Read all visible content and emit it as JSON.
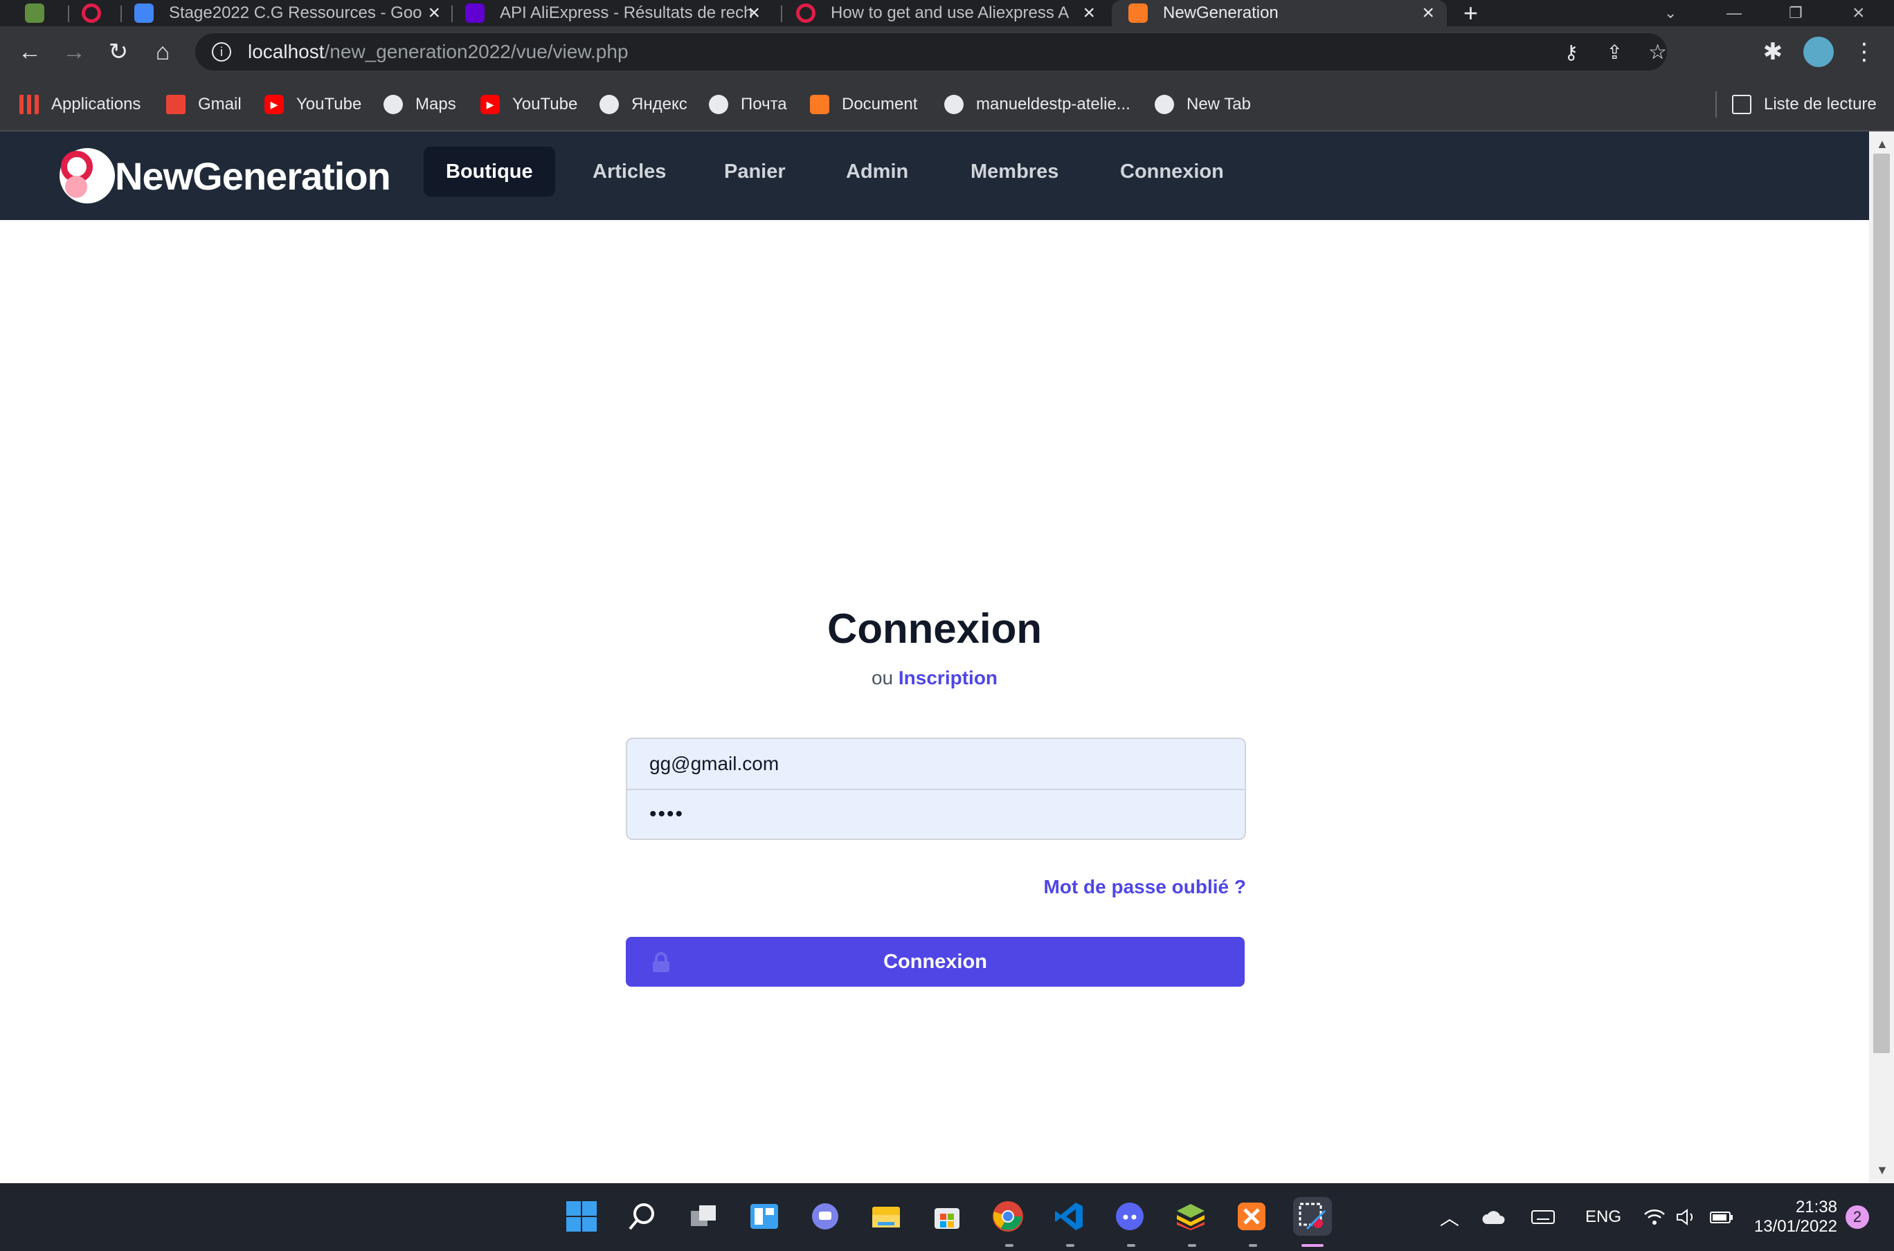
{
  "browser": {
    "tabs": [
      {
        "title": "",
        "favicon": "shopify-icon",
        "color": "#5e8e3e"
      },
      {
        "title": "",
        "favicon": "sync-icon",
        "color": "#e11d48"
      },
      {
        "title": "Stage2022 C.G Ressources - Goo",
        "favicon": "google-docs-icon",
        "color": "#4285f4"
      },
      {
        "title": "API AliExpress - Résultats de rech",
        "favicon": "yahoo-icon",
        "color": "#6001d2"
      },
      {
        "title": "How to get and use Aliexpress A",
        "favicon": "sync-icon",
        "color": "#e11d48"
      },
      {
        "title": "NewGeneration",
        "favicon": "xampp-icon",
        "color": "#fb7a24",
        "active": true
      }
    ],
    "new_tab_label": "+",
    "url_host": "localhost",
    "url_path": "/new_generation2022/vue/view.php",
    "bookmarks": [
      {
        "label": "Applications",
        "icon": "apps-grid-icon"
      },
      {
        "label": "Gmail",
        "icon": "gmail-icon"
      },
      {
        "label": "YouTube",
        "icon": "youtube-icon"
      },
      {
        "label": "Maps",
        "icon": "globe-icon"
      },
      {
        "label": "YouTube",
        "icon": "youtube-icon"
      },
      {
        "label": "Яндекс",
        "icon": "globe-icon"
      },
      {
        "label": "Почта",
        "icon": "globe-icon"
      },
      {
        "label": "Document",
        "icon": "xampp-icon"
      },
      {
        "label": "manueldestp-atelie...",
        "icon": "globe-icon"
      },
      {
        "label": "New Tab",
        "icon": "globe-icon"
      }
    ],
    "reading_list_label": "Liste de lecture"
  },
  "site": {
    "brand": "NewGeneration",
    "nav": [
      {
        "label": "Boutique",
        "active": true
      },
      {
        "label": "Articles"
      },
      {
        "label": "Panier"
      },
      {
        "label": "Admin"
      },
      {
        "label": "Membres"
      },
      {
        "label": "Connexion"
      }
    ]
  },
  "login": {
    "title": "Connexion",
    "or_label": "ou",
    "signup_link": "Inscription",
    "email_value": "gg@gmail.com",
    "password_value": "••••",
    "forgot_link": "Mot de passe oublié ?",
    "submit_label": "Connexion"
  },
  "taskbar": {
    "language": "ENG",
    "time": "21:38",
    "date": "13/01/2022",
    "notification_count": "2"
  },
  "colors": {
    "accent": "#4f46e5",
    "nav_bg": "#1f2937",
    "brand_red": "#e11d48"
  }
}
